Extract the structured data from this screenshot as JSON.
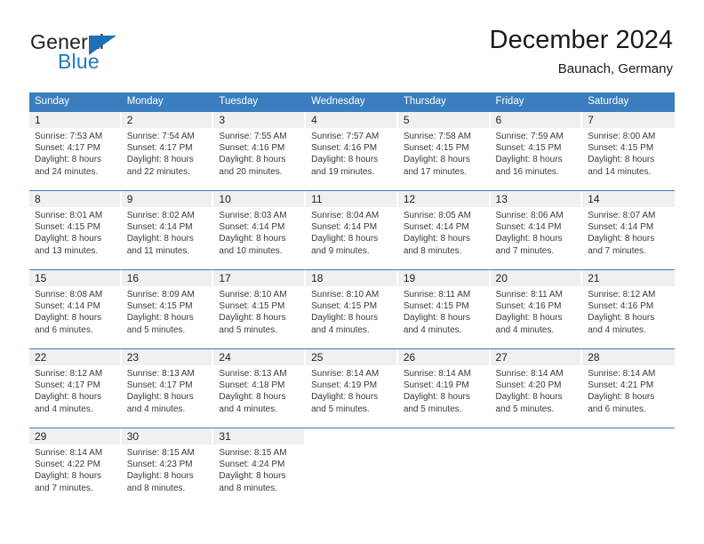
{
  "brand": {
    "line1": "General",
    "line2": "Blue",
    "triangle_icon": "blue-triangle",
    "color_dark": "#222222",
    "color_blue": "#1f7ac4"
  },
  "header": {
    "title": "December 2024",
    "subtitle": "Baunach, Germany"
  },
  "theme": {
    "header_blue": "#3a7ebf",
    "daynum_band": "#f0f0f0",
    "text": "#3a3a3a"
  },
  "calendar": {
    "weekdays": [
      "Sunday",
      "Monday",
      "Tuesday",
      "Wednesday",
      "Thursday",
      "Friday",
      "Saturday"
    ],
    "labels": {
      "sunrise": "Sunrise:",
      "sunset": "Sunset:",
      "daylight": "Daylight:"
    },
    "weeks": [
      [
        {
          "day": "1",
          "sunrise": "Sunrise: 7:53 AM",
          "sunset": "Sunset: 4:17 PM",
          "daylight1": "Daylight: 8 hours",
          "daylight2": "and 24 minutes."
        },
        {
          "day": "2",
          "sunrise": "Sunrise: 7:54 AM",
          "sunset": "Sunset: 4:17 PM",
          "daylight1": "Daylight: 8 hours",
          "daylight2": "and 22 minutes."
        },
        {
          "day": "3",
          "sunrise": "Sunrise: 7:55 AM",
          "sunset": "Sunset: 4:16 PM",
          "daylight1": "Daylight: 8 hours",
          "daylight2": "and 20 minutes."
        },
        {
          "day": "4",
          "sunrise": "Sunrise: 7:57 AM",
          "sunset": "Sunset: 4:16 PM",
          "daylight1": "Daylight: 8 hours",
          "daylight2": "and 19 minutes."
        },
        {
          "day": "5",
          "sunrise": "Sunrise: 7:58 AM",
          "sunset": "Sunset: 4:15 PM",
          "daylight1": "Daylight: 8 hours",
          "daylight2": "and 17 minutes."
        },
        {
          "day": "6",
          "sunrise": "Sunrise: 7:59 AM",
          "sunset": "Sunset: 4:15 PM",
          "daylight1": "Daylight: 8 hours",
          "daylight2": "and 16 minutes."
        },
        {
          "day": "7",
          "sunrise": "Sunrise: 8:00 AM",
          "sunset": "Sunset: 4:15 PM",
          "daylight1": "Daylight: 8 hours",
          "daylight2": "and 14 minutes."
        }
      ],
      [
        {
          "day": "8",
          "sunrise": "Sunrise: 8:01 AM",
          "sunset": "Sunset: 4:15 PM",
          "daylight1": "Daylight: 8 hours",
          "daylight2": "and 13 minutes."
        },
        {
          "day": "9",
          "sunrise": "Sunrise: 8:02 AM",
          "sunset": "Sunset: 4:14 PM",
          "daylight1": "Daylight: 8 hours",
          "daylight2": "and 11 minutes."
        },
        {
          "day": "10",
          "sunrise": "Sunrise: 8:03 AM",
          "sunset": "Sunset: 4:14 PM",
          "daylight1": "Daylight: 8 hours",
          "daylight2": "and 10 minutes."
        },
        {
          "day": "11",
          "sunrise": "Sunrise: 8:04 AM",
          "sunset": "Sunset: 4:14 PM",
          "daylight1": "Daylight: 8 hours",
          "daylight2": "and 9 minutes."
        },
        {
          "day": "12",
          "sunrise": "Sunrise: 8:05 AM",
          "sunset": "Sunset: 4:14 PM",
          "daylight1": "Daylight: 8 hours",
          "daylight2": "and 8 minutes."
        },
        {
          "day": "13",
          "sunrise": "Sunrise: 8:06 AM",
          "sunset": "Sunset: 4:14 PM",
          "daylight1": "Daylight: 8 hours",
          "daylight2": "and 7 minutes."
        },
        {
          "day": "14",
          "sunrise": "Sunrise: 8:07 AM",
          "sunset": "Sunset: 4:14 PM",
          "daylight1": "Daylight: 8 hours",
          "daylight2": "and 7 minutes."
        }
      ],
      [
        {
          "day": "15",
          "sunrise": "Sunrise: 8:08 AM",
          "sunset": "Sunset: 4:14 PM",
          "daylight1": "Daylight: 8 hours",
          "daylight2": "and 6 minutes."
        },
        {
          "day": "16",
          "sunrise": "Sunrise: 8:09 AM",
          "sunset": "Sunset: 4:15 PM",
          "daylight1": "Daylight: 8 hours",
          "daylight2": "and 5 minutes."
        },
        {
          "day": "17",
          "sunrise": "Sunrise: 8:10 AM",
          "sunset": "Sunset: 4:15 PM",
          "daylight1": "Daylight: 8 hours",
          "daylight2": "and 5 minutes."
        },
        {
          "day": "18",
          "sunrise": "Sunrise: 8:10 AM",
          "sunset": "Sunset: 4:15 PM",
          "daylight1": "Daylight: 8 hours",
          "daylight2": "and 4 minutes."
        },
        {
          "day": "19",
          "sunrise": "Sunrise: 8:11 AM",
          "sunset": "Sunset: 4:15 PM",
          "daylight1": "Daylight: 8 hours",
          "daylight2": "and 4 minutes."
        },
        {
          "day": "20",
          "sunrise": "Sunrise: 8:11 AM",
          "sunset": "Sunset: 4:16 PM",
          "daylight1": "Daylight: 8 hours",
          "daylight2": "and 4 minutes."
        },
        {
          "day": "21",
          "sunrise": "Sunrise: 8:12 AM",
          "sunset": "Sunset: 4:16 PM",
          "daylight1": "Daylight: 8 hours",
          "daylight2": "and 4 minutes."
        }
      ],
      [
        {
          "day": "22",
          "sunrise": "Sunrise: 8:12 AM",
          "sunset": "Sunset: 4:17 PM",
          "daylight1": "Daylight: 8 hours",
          "daylight2": "and 4 minutes."
        },
        {
          "day": "23",
          "sunrise": "Sunrise: 8:13 AM",
          "sunset": "Sunset: 4:17 PM",
          "daylight1": "Daylight: 8 hours",
          "daylight2": "and 4 minutes."
        },
        {
          "day": "24",
          "sunrise": "Sunrise: 8:13 AM",
          "sunset": "Sunset: 4:18 PM",
          "daylight1": "Daylight: 8 hours",
          "daylight2": "and 4 minutes."
        },
        {
          "day": "25",
          "sunrise": "Sunrise: 8:14 AM",
          "sunset": "Sunset: 4:19 PM",
          "daylight1": "Daylight: 8 hours",
          "daylight2": "and 5 minutes."
        },
        {
          "day": "26",
          "sunrise": "Sunrise: 8:14 AM",
          "sunset": "Sunset: 4:19 PM",
          "daylight1": "Daylight: 8 hours",
          "daylight2": "and 5 minutes."
        },
        {
          "day": "27",
          "sunrise": "Sunrise: 8:14 AM",
          "sunset": "Sunset: 4:20 PM",
          "daylight1": "Daylight: 8 hours",
          "daylight2": "and 5 minutes."
        },
        {
          "day": "28",
          "sunrise": "Sunrise: 8:14 AM",
          "sunset": "Sunset: 4:21 PM",
          "daylight1": "Daylight: 8 hours",
          "daylight2": "and 6 minutes."
        }
      ],
      [
        {
          "day": "29",
          "sunrise": "Sunrise: 8:14 AM",
          "sunset": "Sunset: 4:22 PM",
          "daylight1": "Daylight: 8 hours",
          "daylight2": "and 7 minutes."
        },
        {
          "day": "30",
          "sunrise": "Sunrise: 8:15 AM",
          "sunset": "Sunset: 4:23 PM",
          "daylight1": "Daylight: 8 hours",
          "daylight2": "and 8 minutes."
        },
        {
          "day": "31",
          "sunrise": "Sunrise: 8:15 AM",
          "sunset": "Sunset: 4:24 PM",
          "daylight1": "Daylight: 8 hours",
          "daylight2": "and 8 minutes."
        },
        {
          "day": "",
          "sunrise": "",
          "sunset": "",
          "daylight1": "",
          "daylight2": ""
        },
        {
          "day": "",
          "sunrise": "",
          "sunset": "",
          "daylight1": "",
          "daylight2": ""
        },
        {
          "day": "",
          "sunrise": "",
          "sunset": "",
          "daylight1": "",
          "daylight2": ""
        },
        {
          "day": "",
          "sunrise": "",
          "sunset": "",
          "daylight1": "",
          "daylight2": ""
        }
      ]
    ]
  }
}
